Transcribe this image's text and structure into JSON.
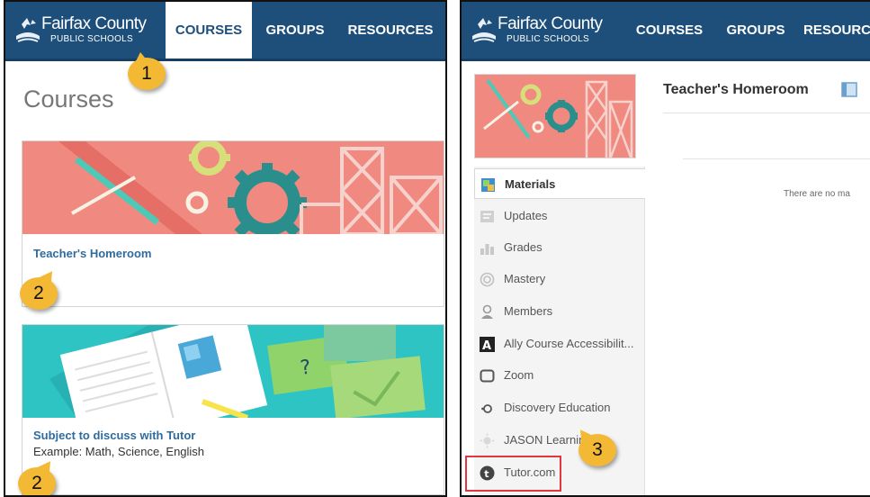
{
  "logo": {
    "line1": "Fairfax County",
    "line2": "PUBLIC SCHOOLS"
  },
  "nav": {
    "courses": "COURSES",
    "groups": "GROUPS",
    "resources": "RESOURCES",
    "resources_cropped": "RESOURC"
  },
  "callouts": {
    "one": "1",
    "two": "2",
    "three": "3"
  },
  "left": {
    "heading": "Courses",
    "courses": [
      {
        "title": "Teacher's Homeroom",
        "subtitle": ""
      },
      {
        "title": "Subject to discuss with Tutor",
        "subtitle": "Example: Math, Science, English"
      }
    ]
  },
  "right": {
    "course_title": "Teacher's Homeroom",
    "empty_text": "There are no ma",
    "menu": [
      {
        "label": "Materials",
        "icon": "materials-icon"
      },
      {
        "label": "Updates",
        "icon": "updates-icon"
      },
      {
        "label": "Grades",
        "icon": "grades-icon"
      },
      {
        "label": "Mastery",
        "icon": "mastery-icon"
      },
      {
        "label": "Members",
        "icon": "members-icon"
      },
      {
        "label": "Ally Course Accessibilit...",
        "icon": "ally-icon"
      },
      {
        "label": "Zoom",
        "icon": "zoom-icon"
      },
      {
        "label": "Discovery Education",
        "icon": "discovery-education-icon"
      },
      {
        "label": "JASON Learning",
        "icon": "jason-learning-icon"
      },
      {
        "label": "Tutor.com",
        "icon": "tutor-icon"
      }
    ]
  },
  "colors": {
    "header_blue": "#1d4f7a",
    "link_blue": "#2e6b9e",
    "callout_yellow": "#f4b934",
    "highlight_red": "#e0383e",
    "banner_salmon": "#f08a80",
    "banner_teal": "#2ec4c4"
  }
}
